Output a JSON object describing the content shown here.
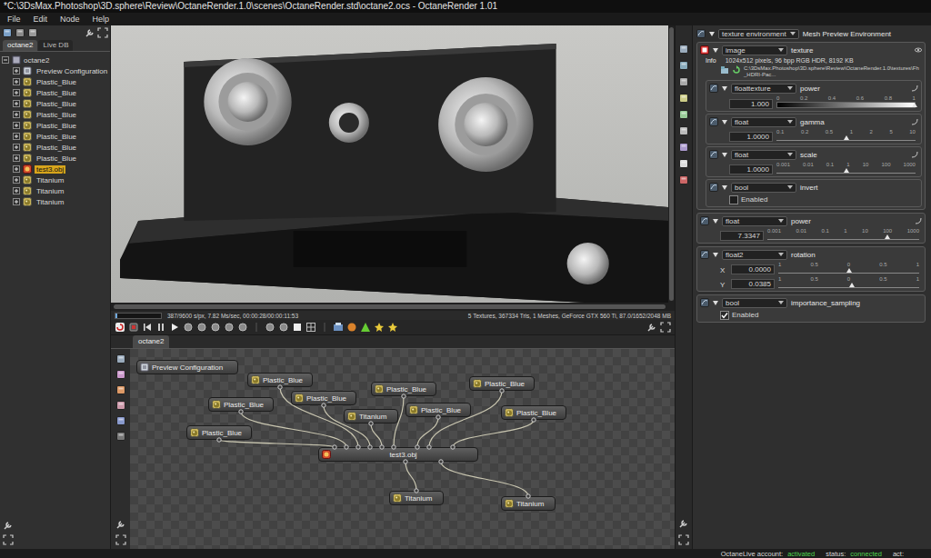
{
  "window": {
    "title": "*C:\\3DsMax.Photoshop\\3D.sphere\\Review\\OctaneRender.1.0\\scenes\\OctaneRender.std\\octane2.ocs - OctaneRender 1.01"
  },
  "menu": [
    "File",
    "Edit",
    "Node",
    "Help"
  ],
  "left_panel": {
    "tabs": [
      {
        "label": "octane2",
        "selected": true
      },
      {
        "label": "Live DB",
        "selected": false
      }
    ],
    "tree": {
      "root": "octane2",
      "expanded": true,
      "items": [
        {
          "label": "Preview Configuration",
          "kind": "config",
          "expanded": false,
          "selected": false
        },
        {
          "label": "Plastic_Blue",
          "kind": "material",
          "expanded": false,
          "selected": false
        },
        {
          "label": "Plastic_Blue",
          "kind": "material",
          "expanded": false,
          "selected": false
        },
        {
          "label": "Plastic_Blue",
          "kind": "material",
          "expanded": false,
          "selected": false
        },
        {
          "label": "Plastic_Blue",
          "kind": "material",
          "expanded": false,
          "selected": false
        },
        {
          "label": "Plastic_Blue",
          "kind": "material",
          "expanded": false,
          "selected": false
        },
        {
          "label": "Plastic_Blue",
          "kind": "material",
          "expanded": false,
          "selected": false
        },
        {
          "label": "Plastic_Blue",
          "kind": "material",
          "expanded": false,
          "selected": false
        },
        {
          "label": "Plastic_Blue",
          "kind": "material",
          "expanded": false,
          "selected": false
        },
        {
          "label": "test3.obj",
          "kind": "mesh",
          "expanded": false,
          "selected": true
        },
        {
          "label": "Titanium",
          "kind": "material",
          "expanded": false,
          "selected": false
        },
        {
          "label": "Titanium",
          "kind": "material",
          "expanded": false,
          "selected": false
        },
        {
          "label": "Titanium",
          "kind": "material",
          "expanded": false,
          "selected": false
        }
      ]
    }
  },
  "viewport": {
    "progress_level": 0.04,
    "status_left": "387/9600 s/px, 7.82 Ms/sec, 00:00:28/00:00:11:53",
    "status_right": "5 Textures, 367334 Tris, 1 Meshes, GeForce GTX 560 Ti, 87.0/1652/2048 MB"
  },
  "node_graph": {
    "tab": "octane2",
    "nodes": [
      {
        "label": "Preview Configuration",
        "kind": "config",
        "selected": false
      },
      {
        "label": "Plastic_Blue",
        "kind": "material",
        "selected": false
      },
      {
        "label": "Plastic_Blue",
        "kind": "material",
        "selected": false
      },
      {
        "label": "Plastic_Blue",
        "kind": "material",
        "selected": false
      },
      {
        "label": "Plastic_Blue",
        "kind": "material",
        "selected": false
      },
      {
        "label": "Titanium",
        "kind": "material",
        "selected": false
      },
      {
        "label": "Plastic_Blue",
        "kind": "material",
        "selected": false
      },
      {
        "label": "Plastic_Blue",
        "kind": "material",
        "selected": false
      },
      {
        "label": "Plastic_Blue",
        "kind": "material",
        "selected": false
      },
      {
        "label": "Plastic_Blue",
        "kind": "material",
        "selected": false
      },
      {
        "label": "test3.obj",
        "kind": "mesh",
        "selected": false
      },
      {
        "label": "Titanium",
        "kind": "material",
        "selected": false
      },
      {
        "label": "Titanium",
        "kind": "material",
        "selected": false
      }
    ],
    "edges": [
      {
        "from": 9,
        "to": 10
      },
      {
        "from": 2,
        "to": 10
      },
      {
        "from": 1,
        "to": 10
      },
      {
        "from": 3,
        "to": 10
      },
      {
        "from": 5,
        "to": 10
      },
      {
        "from": 4,
        "to": 10
      },
      {
        "from": 11,
        "to": 10
      },
      {
        "from": 6,
        "to": 10
      },
      {
        "from": 7,
        "to": 10
      },
      {
        "from": 12,
        "to": 10
      },
      {
        "from": 8,
        "to": 10
      }
    ]
  },
  "inspector": {
    "header": {
      "type": "texture environment",
      "name": "Mesh Preview Environment",
      "expanded": true
    },
    "params": [
      {
        "kind": "image",
        "type": "image",
        "name": "texture",
        "expanded": true,
        "info": {
          "label": "Info",
          "value": "1024x512 pixels, 96 bpp RGB HDR, 8192 KB"
        },
        "path": "C:\\3DsMax.Photoshop\\3D.sphere\\Review\\OctaneRender.1.0\\textures\\Fh_HDRI-Pac...",
        "children": [
          {
            "kind": "texture-slider",
            "type": "floattexture",
            "name": "power",
            "expanded": true,
            "value": "1.000",
            "ticks": [
              "0",
              "0.2",
              "0.4",
              "0.6",
              "0.8",
              "1"
            ],
            "level": 1.0
          },
          {
            "kind": "slider",
            "type": "float",
            "name": "gamma",
            "expanded": true,
            "value": "1.0000",
            "ticks": [
              "0.1",
              "0.2",
              "0.5",
              "1",
              "2",
              "5",
              "10"
            ],
            "level": 0.5
          },
          {
            "kind": "slider",
            "type": "float",
            "name": "scale",
            "expanded": true,
            "value": "1.0000",
            "ticks": [
              "0.001",
              "0.01",
              "0.1",
              "1",
              "10",
              "100",
              "1000"
            ],
            "level": 0.5
          },
          {
            "kind": "bool",
            "type": "bool",
            "name": "invert",
            "expanded": true,
            "option": "Enabled",
            "checked": false
          }
        ]
      },
      {
        "kind": "slider",
        "type": "float",
        "name": "power",
        "expanded": true,
        "value": "7.3347",
        "ticks": [
          "0.001",
          "0.01",
          "0.1",
          "1",
          "10",
          "100",
          "1000"
        ],
        "level": 0.79
      },
      {
        "kind": "vector",
        "type": "float2",
        "name": "rotation",
        "expanded": true,
        "rows": [
          {
            "axis": "X",
            "value": "0.0000",
            "ticks": [
              "1",
              "0.5",
              "0",
              "0.5",
              "1"
            ],
            "level": 0.5
          },
          {
            "axis": "Y",
            "value": "0.0385",
            "ticks": [
              "1",
              "0.5",
              "0",
              "0.5",
              "1"
            ],
            "level": 0.52
          }
        ]
      },
      {
        "kind": "bool",
        "type": "bool",
        "name": "importance_sampling",
        "expanded": true,
        "option": "Enabled",
        "checked": true
      }
    ]
  },
  "status_bar": {
    "items": [
      {
        "label": "OctaneLive account:",
        "value": "activated",
        "ok": true
      },
      {
        "label": "status:",
        "value": "connected",
        "ok": true
      },
      {
        "label": "act:"
      }
    ]
  }
}
